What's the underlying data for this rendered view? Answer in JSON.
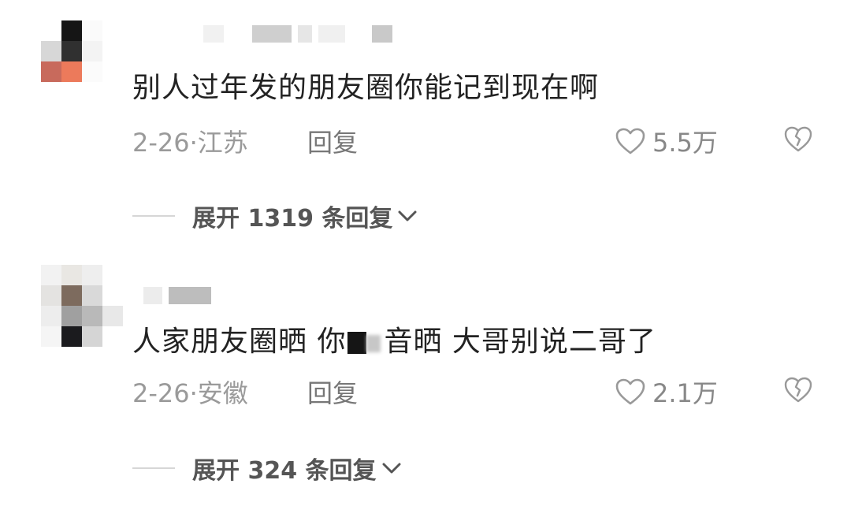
{
  "comments": [
    {
      "text": "别人过年发的朋友圈你能记到现在啊",
      "date": "2-26·",
      "location": "江苏",
      "reply_label": "回复",
      "likes": "5.5万",
      "expand_label": "展开 1319 条回复"
    },
    {
      "text_before": "人家朋友圈晒 你",
      "text_after": "音晒 大哥别说二哥了",
      "date": "2-26·",
      "location": "安徽",
      "reply_label": "回复",
      "likes": "2.1万",
      "expand_label": "展开 324 条回复"
    }
  ],
  "icons": {
    "like": "heart-outline-icon",
    "dislike": "broken-heart-icon",
    "expand": "chevron-down-icon"
  },
  "colors": {
    "text": "#222222",
    "meta": "#9a9a9a",
    "icon": "#999999"
  }
}
